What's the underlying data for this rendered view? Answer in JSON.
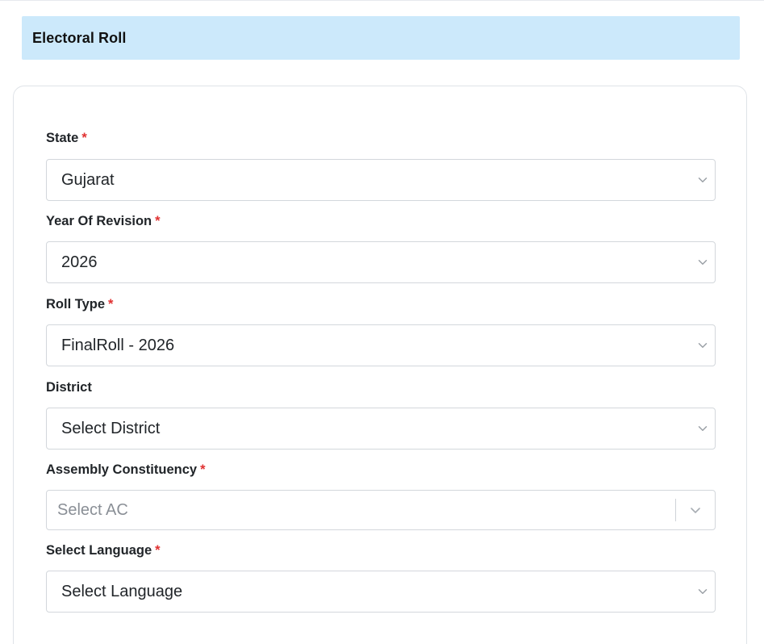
{
  "header": {
    "title": "Electoral Roll"
  },
  "form": {
    "required_mark": "*",
    "state": {
      "label": "State",
      "value": "Gujarat"
    },
    "year_of_revision": {
      "label": "Year Of Revision",
      "value": "2026"
    },
    "roll_type": {
      "label": "Roll Type",
      "value": "FinalRoll - 2026"
    },
    "district": {
      "label": "District",
      "value": "Select District"
    },
    "assembly_constituency": {
      "label": "Assembly Constituency",
      "placeholder": "Select AC"
    },
    "language": {
      "label": "Select Language",
      "value": "Select Language"
    }
  },
  "icons": {
    "dropdown": "chevron-down-icon"
  },
  "colors": {
    "header_bg": "#cce9fb",
    "required": "#e03131",
    "border": "#d3d7dc"
  }
}
